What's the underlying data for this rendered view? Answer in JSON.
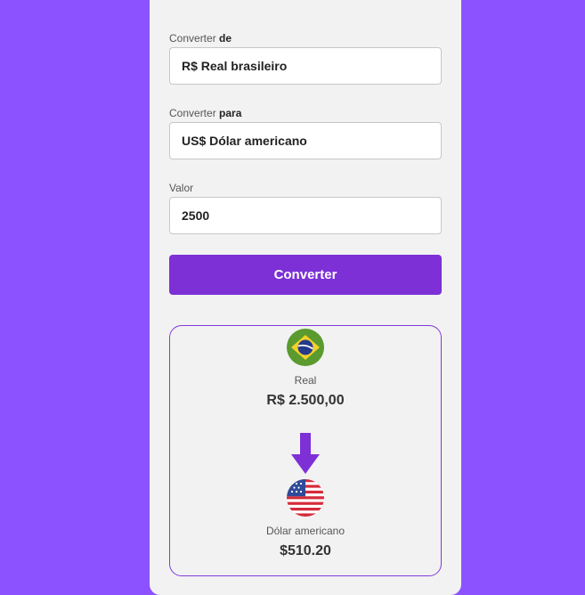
{
  "form": {
    "from": {
      "label_prefix": "Converter ",
      "label_bold": "de",
      "value": "R$ Real brasileiro"
    },
    "to": {
      "label_prefix": "Converter ",
      "label_bold": "para",
      "value": "US$ Dólar americano"
    },
    "amount": {
      "label": "Valor",
      "value": "2500"
    },
    "convert_button": "Converter"
  },
  "result": {
    "source": {
      "name": "Real",
      "value": "R$ 2.500,00",
      "flag_icon": "brazil-flag-icon"
    },
    "target": {
      "name": "Dólar americano",
      "value": "$510.20",
      "flag_icon": "usa-flag-icon"
    }
  },
  "colors": {
    "background": "#8c52ff",
    "accent": "#7d30d6",
    "card": "#f2f2f2"
  }
}
